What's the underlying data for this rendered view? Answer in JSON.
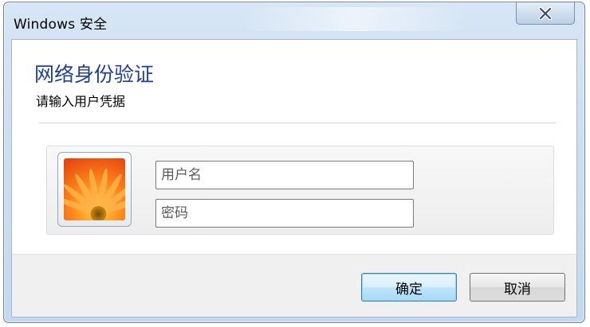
{
  "window": {
    "title": "Windows 安全"
  },
  "titlebar": {
    "close_icon": "close-icon"
  },
  "dialog": {
    "heading": "网络身份验证",
    "subheading": "请输入用户凭据"
  },
  "credentials": {
    "avatar_icon": "user-tile-flower",
    "username_placeholder": "用户名",
    "password_placeholder": "密码",
    "username_value": "",
    "password_value": ""
  },
  "buttons": {
    "ok_label": "确定",
    "cancel_label": "取消"
  },
  "colors": {
    "heading": "#1e3f94",
    "default_button_border": "#3c7fb1",
    "frame": "#cddff2"
  }
}
